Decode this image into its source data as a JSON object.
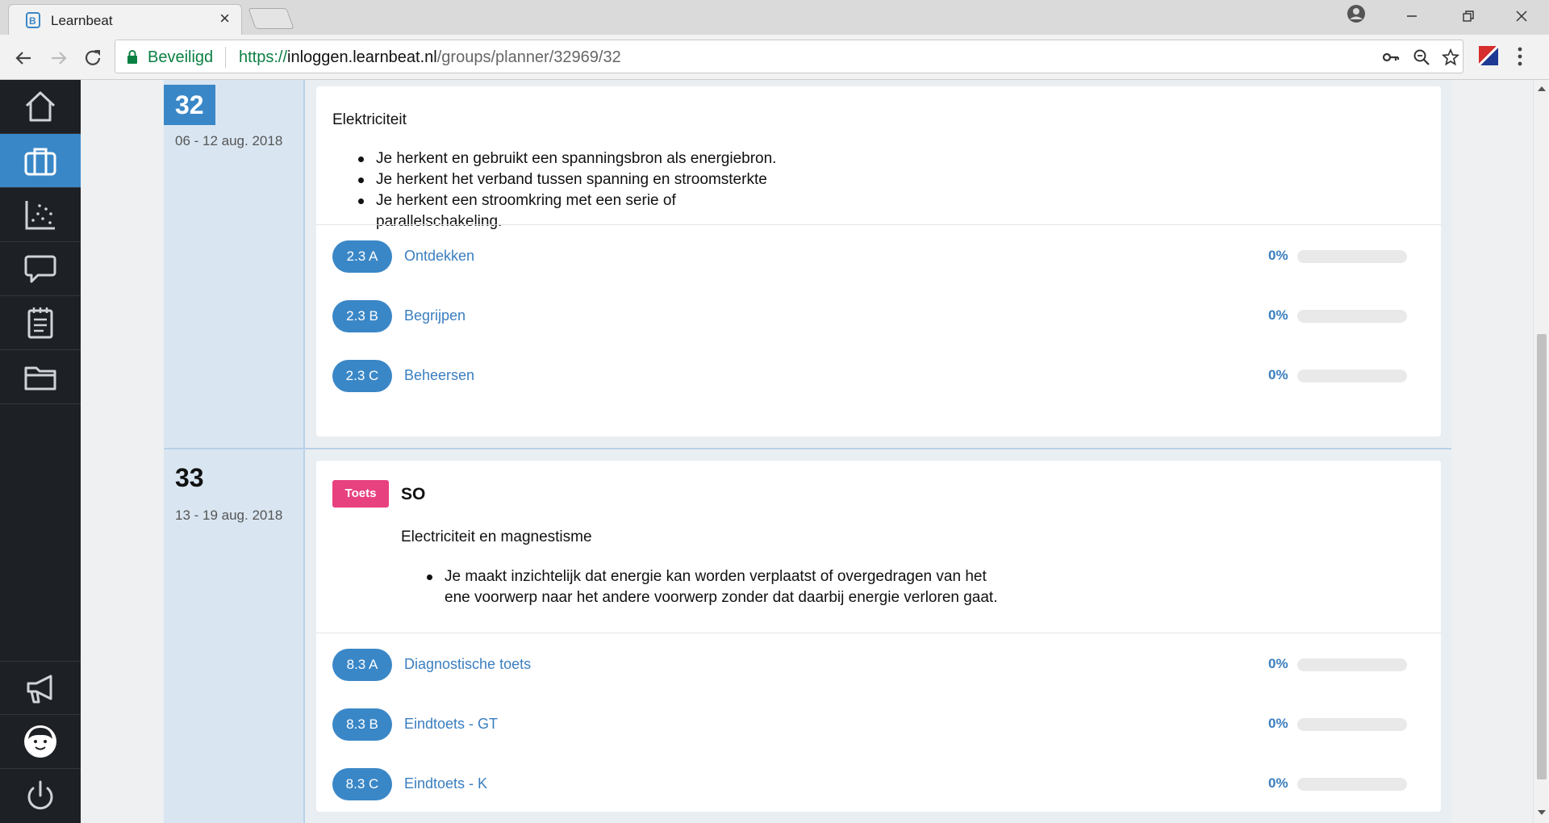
{
  "browser": {
    "tab_title": "Learnbeat",
    "tab_close": "×",
    "secure_label": "Beveiligd",
    "url_scheme": "https://",
    "url_host": "inloggen.learnbeat.nl",
    "url_path": "/groups/planner/32969/32"
  },
  "sidebar": {
    "items": [
      {
        "name": "home",
        "icon": "home-icon"
      },
      {
        "name": "briefcase",
        "icon": "briefcase-icon",
        "active": true
      },
      {
        "name": "results",
        "icon": "scatter-chart-icon"
      },
      {
        "name": "messages",
        "icon": "speech-bubble-icon"
      },
      {
        "name": "notes",
        "icon": "notepad-icon"
      },
      {
        "name": "files",
        "icon": "folder-icon"
      }
    ],
    "bottom": [
      {
        "name": "announcements",
        "icon": "megaphone-icon"
      },
      {
        "name": "profile",
        "icon": "avatar-icon"
      },
      {
        "name": "logout",
        "icon": "power-icon"
      }
    ]
  },
  "weeks": [
    {
      "number": "32",
      "dates": "06 - 12 aug. 2018",
      "current": true,
      "topic": "Elektriciteit",
      "goals": [
        "Je herkent en gebruikt een spanningsbron als energiebron.",
        "Je herkent het verband tussen spanning en stroomsterkte",
        "Je herkent een stroomkring met een serie of",
        "parallelschakeling."
      ],
      "tasks": [
        {
          "code": "2.3 A",
          "title": "Ontdekken",
          "percent": "0%",
          "progress": 0
        },
        {
          "code": "2.3 B",
          "title": "Begrijpen",
          "percent": "0%",
          "progress": 0
        },
        {
          "code": "2.3 C",
          "title": "Beheersen",
          "percent": "0%",
          "progress": 0
        }
      ]
    },
    {
      "number": "33",
      "dates": "13 - 19 aug. 2018",
      "current": false,
      "badge": "Toets",
      "title": "SO",
      "topic": "Electriciteit en magnestisme",
      "goals": [
        "Je maakt inzichtelijk dat energie kan worden verplaatst of overgedragen van het",
        "ene voorwerp naar het andere voorwerp zonder dat daarbij energie verloren gaat."
      ],
      "tasks": [
        {
          "code": "8.3 A",
          "title": "Diagnostische toets",
          "percent": "0%",
          "progress": 0
        },
        {
          "code": "8.3 B",
          "title": "Eindtoets - GT",
          "percent": "0%",
          "progress": 0
        },
        {
          "code": "8.3 C",
          "title": "Eindtoets - K",
          "percent": "0%",
          "progress": 0
        }
      ]
    }
  ],
  "colors": {
    "accent": "#3a87c7",
    "link": "#3a7ebf",
    "toets": "#e8417f",
    "sidebar": "#1d2025"
  }
}
